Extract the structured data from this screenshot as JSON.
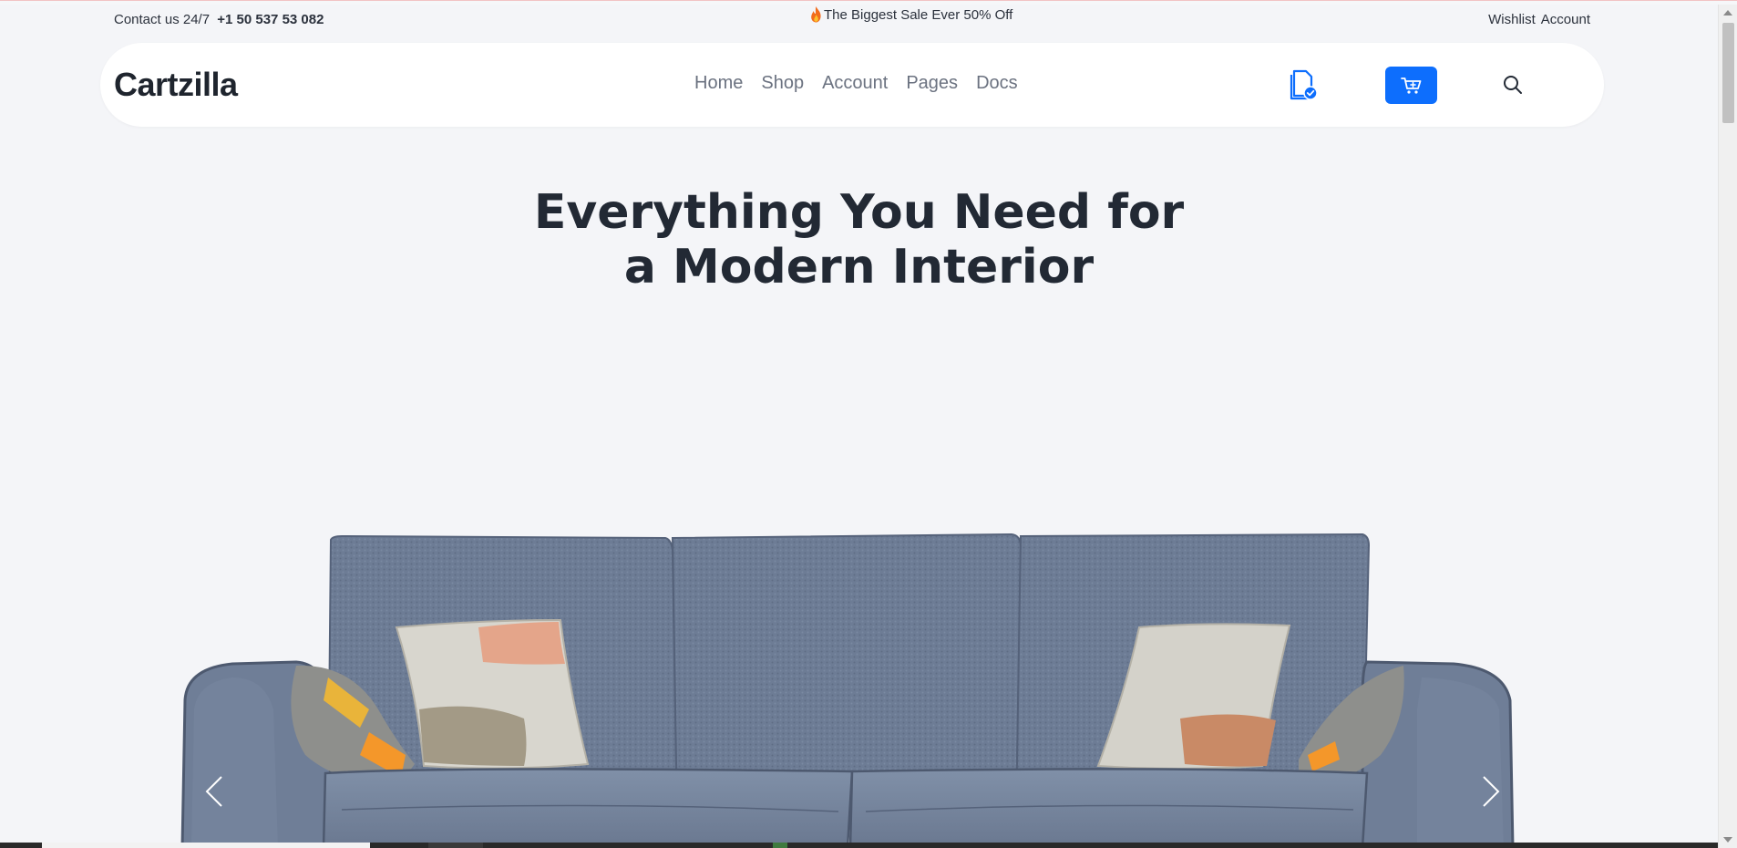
{
  "topbar": {
    "contact_label": "Contact us 24/7",
    "phone": "+1 50 537 53 082",
    "promo_text": "The Biggest Sale Ever 50% Off",
    "wishlist": "Wishlist",
    "account": "Account"
  },
  "navbar": {
    "brand": "Cartzilla",
    "menu": [
      "Home",
      "Shop",
      "Account",
      "Pages",
      "Docs"
    ],
    "cart_color": "#0d6efd"
  },
  "hero": {
    "title_line1": "Everything You Need for",
    "title_line2": "a Modern Interior"
  },
  "icons": {
    "fire": "fire-icon",
    "document": "document-check-icon",
    "cart": "cart-icon",
    "search": "search-icon",
    "prev": "chevron-left-icon",
    "next": "chevron-right-icon"
  }
}
